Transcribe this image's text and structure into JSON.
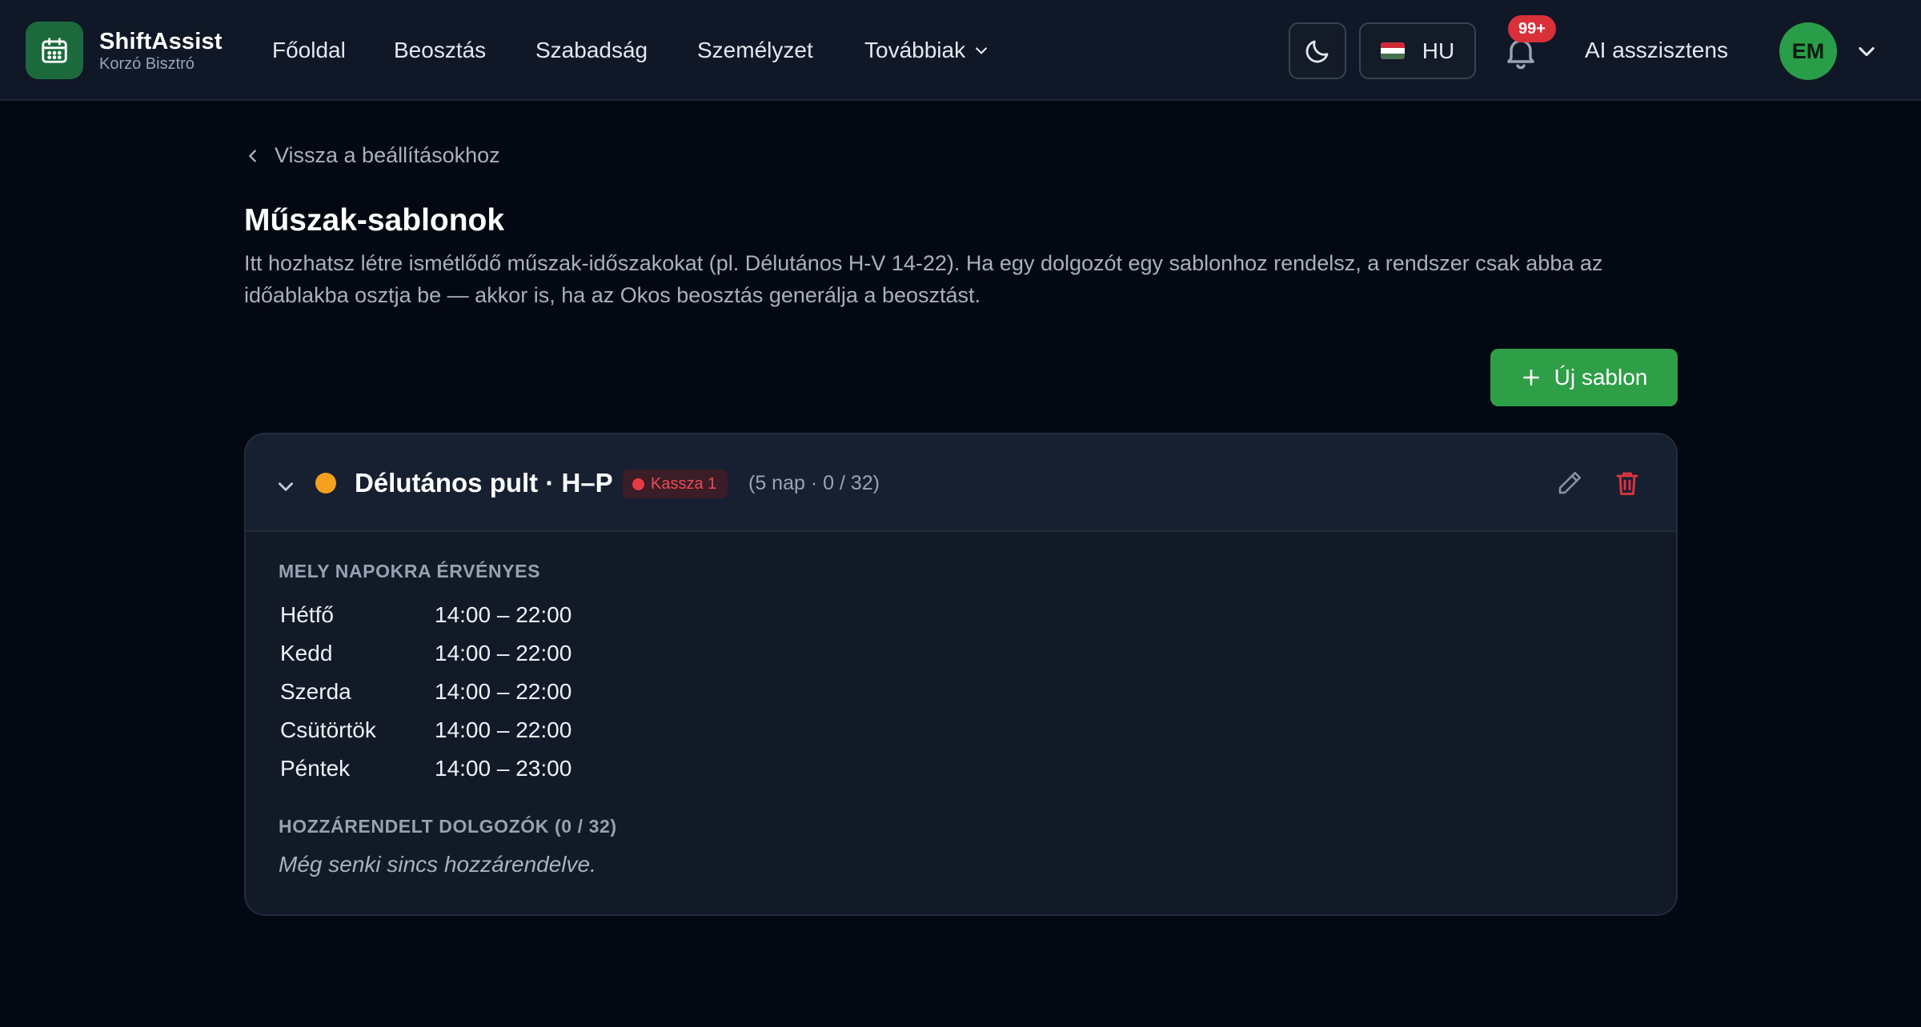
{
  "brand": {
    "name": "ShiftAssist",
    "subtitle": "Korzó Bisztró",
    "accent": "#2e9e47"
  },
  "nav": {
    "items": [
      "Főoldal",
      "Beosztás",
      "Szabadság",
      "Személyzet"
    ],
    "more_label": "Továbbiak",
    "theme_icon": "moon-icon",
    "language": "HU",
    "notifications_badge": "99+",
    "ai_label": "AI asszisztens",
    "user_initials": "EM"
  },
  "page": {
    "back_label": "Vissza a beállításokhoz",
    "title": "Műszak-sablonok",
    "description": "Itt hozhatsz létre ismétlődő műszak-időszakokat (pl. Délutános H-V 14-22). Ha egy dolgozót egy sablonhoz rendelsz, a rendszer csak abba az időablakba osztja be — akkor is, ha az Okos beosztás generálja a beosztást.",
    "new_button_label": "Új sablon"
  },
  "template": {
    "name": "Délutános pult · H–P",
    "color": "#f5a11d",
    "location_badge": "Kassza 1",
    "location_color": "#e63946",
    "meta": "(5 nap · 0 / 32)",
    "days_heading": "MELY NAPOKRA ÉRVÉNYES",
    "days": [
      {
        "day": "Hétfő",
        "time": "14:00 – 22:00"
      },
      {
        "day": "Kedd",
        "time": "14:00 – 22:00"
      },
      {
        "day": "Szerda",
        "time": "14:00 – 22:00"
      },
      {
        "day": "Csütörtök",
        "time": "14:00 – 22:00"
      },
      {
        "day": "Péntek",
        "time": "14:00 – 23:00"
      }
    ],
    "assigned_heading": "HOZZÁRENDELT DOLGOZÓK (0 / 32)",
    "assigned_empty": "Még senki sincs hozzárendelve."
  }
}
